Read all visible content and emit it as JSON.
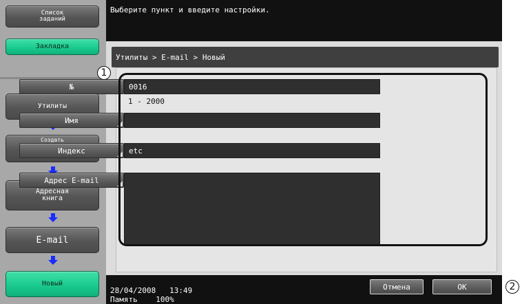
{
  "left_panel": {
    "job_list": "Список\nзаданий",
    "bookmark": "Закладка",
    "steps": [
      "Утилиты",
      "Создать\nполучателя для\nнабора в одно\nкасание",
      "Адресная\nкнига",
      "E-mail",
      "Новый"
    ]
  },
  "message": "Выберите пункт и введите настройки.",
  "breadcrumb": "Утилиты > E-mail > Новый",
  "fields": {
    "number": {
      "label": "№",
      "value": "0016",
      "range": "1 - 2000"
    },
    "name": {
      "label": "Имя",
      "value": ""
    },
    "index": {
      "label": "Индекс",
      "value": "etc"
    },
    "email": {
      "label": "Адрес E-mail",
      "value": ""
    }
  },
  "status": {
    "date": "28/04/2008",
    "time": "13:49",
    "memory_label": "Память",
    "memory_value": "100%"
  },
  "buttons": {
    "cancel": "Отмена",
    "ok": "OK"
  },
  "callouts": {
    "one": "1",
    "two": "2"
  },
  "colors": {
    "accent_green": "#18c88c",
    "panel_dark": "#2f2f2f"
  }
}
